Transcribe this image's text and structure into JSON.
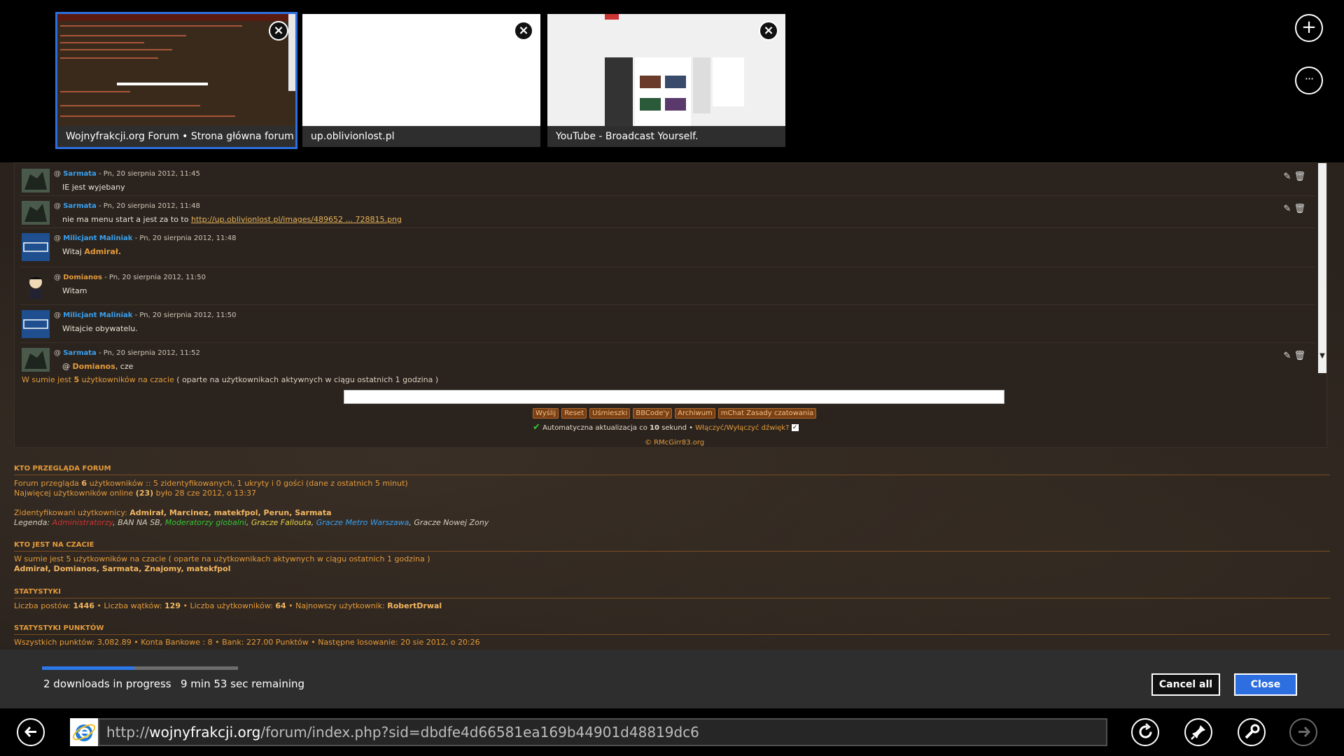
{
  "tabs": [
    {
      "title": "Wojnyfrakcji.org Forum • Strona główna forum",
      "active": true
    },
    {
      "title": "up.oblivionlost.pl",
      "active": false
    },
    {
      "title": "YouTube - Broadcast Yourself.",
      "active": false
    }
  ],
  "tab_close_icon": "×",
  "new_tab_icon": "+",
  "more_icon": "···",
  "chat": {
    "messages": [
      {
        "user": "Sarmata",
        "user_color": "#3aa0ef",
        "sep": " - ",
        "date": "Pn, 20 sierpnia 2012, 11:45",
        "text_pre": "IE jest wyjebany",
        "text_bold": "",
        "text_link": "",
        "has_actions": true
      },
      {
        "user": "Sarmata",
        "user_color": "#3aa0ef",
        "sep": " - ",
        "date": "Pn, 20 sierpnia 2012, 11:48",
        "text_pre": "nie ma menu start a jest za to to ",
        "text_bold": "",
        "text_link": "http://up.oblivionlost.pl/images/489652 ... 728815.png",
        "has_actions": true
      },
      {
        "user": "Milicjant Maliniak",
        "user_color": "#3aa0ef",
        "sep": " - ",
        "date": "Pn, 20 sierpnia 2012, 11:48",
        "text_pre": "Witaj ",
        "text_bold": "Admirał.",
        "text_link": "",
        "has_actions": false
      },
      {
        "user": "Domianos",
        "user_color": "#e49a3a",
        "sep": " - ",
        "date": "Pn, 20 sierpnia 2012, 11:50",
        "text_pre": "Witam",
        "text_bold": "",
        "text_link": "",
        "has_actions": false
      },
      {
        "user": "Milicjant Maliniak",
        "user_color": "#3aa0ef",
        "sep": " - ",
        "date": "Pn, 20 sierpnia 2012, 11:50",
        "text_pre": "Witajcie obywatelu.",
        "text_bold": "",
        "text_link": "",
        "has_actions": false
      },
      {
        "user": "Sarmata",
        "user_color": "#3aa0ef",
        "sep": " - ",
        "date": "Pn, 20 sierpnia 2012, 11:52",
        "text_pre": "@ ",
        "text_bold": "Domianos",
        "text_post": ", cze",
        "text_link": "",
        "has_actions": true
      }
    ],
    "online_prefix": "W sumie jest ",
    "online_count": "5",
    "online_mid": " użytkowników na czacie",
    "online_suffix": " ( oparte na użytkownikach aktywnych w ciągu ostatnich 1 godzina )",
    "buttons": [
      "Wyślij",
      "Reset",
      "Uśmieszki",
      "BBCode'y",
      "Archiwum",
      "mChat Zasady czatowania"
    ],
    "autoupdate_pre": "Automatyczna aktualizacja co ",
    "autoupdate_num": "10",
    "autoupdate_post": " sekund • ",
    "sound_toggle": "Włączyć/Wyłączyć dźwięk?",
    "sound_checked": "✓",
    "copyright": "© RMcGirr83.org"
  },
  "sections": {
    "who_forum": {
      "title": "KTO PRZEGLĄDA FORUM",
      "line1_pre": "Forum przegląda ",
      "line1_num": "6",
      "line1_post": " użytkowników :: 5 zidentyfikowanych, 1 ukryty i 0 gości (dane z ostatnich 5 minut)",
      "line2_pre": "Najwięcej użytkowników online ",
      "line2_num": "(23)",
      "line2_post": " było 28 cze 2012, o 13:37",
      "identified_label": "Zidentyfikowani użytkownicy: ",
      "identified_users": "Admirał, Marcinez, matekfpol, Perun, ",
      "identified_blue": "Sarmata",
      "legend_label": "Legenda: ",
      "legend_admins": "Administratorzy",
      "legend_ban": ", BAN NA SB, ",
      "legend_globalmods": "Moderatorzy globalni",
      "legend_sep1": ", ",
      "legend_fallout": "Gracze Fallouta",
      "legend_sep2": ", ",
      "legend_metro": "Gracze Metro Warszawa",
      "legend_nowa": ", Gracze Nowej Zony"
    },
    "who_chat": {
      "title": "KTO JEST NA CZACIE",
      "line1": "W sumie jest 5 użytkowników na czacie ( oparte na użytkownikach aktywnych w ciągu ostatnich 1 godzina )",
      "users_a": "Admirał, Domianos, ",
      "users_blue": "Sarmata",
      "users_b": ", Znajomy, matekfpol"
    },
    "stats": {
      "title": "STATYSTYKI",
      "posts_label": "Liczba postów: ",
      "posts": "1446",
      "threads_label": " • Liczba wątków: ",
      "threads": "129",
      "users_label": " • Liczba użytkowników: ",
      "users": "64",
      "newest_label": " • Najnowszy użytkownik: ",
      "newest": "RobertDrwal"
    },
    "points": {
      "title": "STATYSTYKI PUNKTÓW",
      "line": "Wszystkich punktów: 3,082.89 • Konta Bankowe : 8 • Bank: 227.00 Punktów • Następne losowanie: 20 sie 2012, o 20:26"
    }
  },
  "downloads": {
    "count_text": "2 downloads in progress",
    "remaining_text": "9 min 53 sec remaining",
    "progress_fraction": 0.47,
    "cancel_label": "Cancel all",
    "close_label": "Close"
  },
  "address": {
    "url_prefix": "http://",
    "url_domain": "wojnyfrakcji.org",
    "url_rest": "/forum/index.php?sid=dbdfe4d66581ea169b44901d48819dc6"
  },
  "icons": {
    "back": "back-arrow-icon",
    "refresh": "refresh-icon",
    "pin": "pin-icon",
    "tools": "wrench-icon",
    "forward": "forward-arrow-icon",
    "ie": "internet-explorer-logo"
  },
  "colors": {
    "accent": "#2d6fe0",
    "forum_orange": "#e49a3a",
    "forum_blue": "#3aa0ef"
  }
}
